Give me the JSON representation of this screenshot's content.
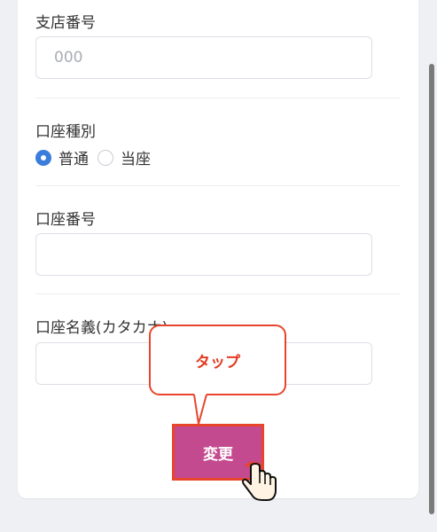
{
  "form": {
    "branch_number": {
      "label": "支店番号",
      "placeholder": "000",
      "value": ""
    },
    "account_type": {
      "label": "口座種別",
      "options": [
        {
          "label": "普通",
          "selected": true
        },
        {
          "label": "当座",
          "selected": false
        }
      ]
    },
    "account_number": {
      "label": "口座番号",
      "value": ""
    },
    "account_holder": {
      "label": "口座名義(カタカナ)",
      "value": ""
    }
  },
  "tooltip": {
    "text": "タップ"
  },
  "submit": {
    "label": "変更"
  },
  "colors": {
    "accent": "#3b7ddd",
    "button": "#c44a8f",
    "highlight": "#e8452c"
  },
  "icons": {
    "pointer": "hand-tap-icon"
  }
}
